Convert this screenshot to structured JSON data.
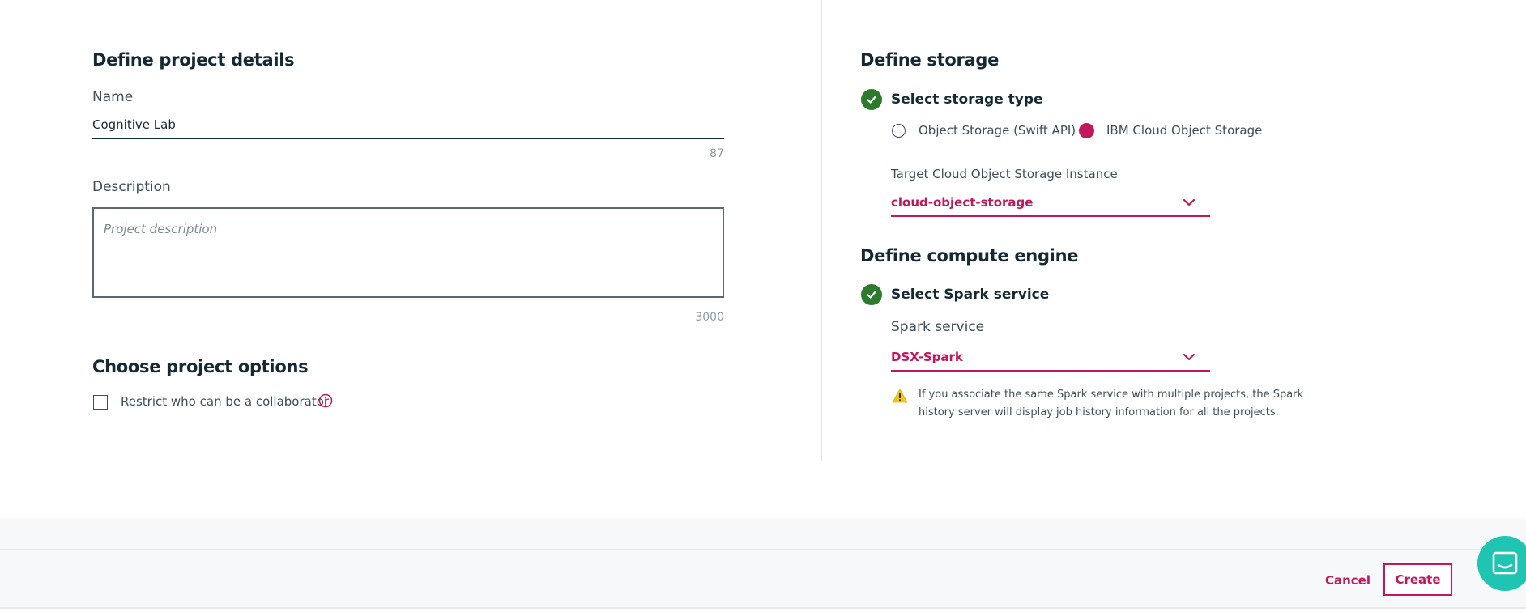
{
  "project_details": {
    "heading": "Define project details",
    "name_label": "Name",
    "name_value": "Cognitive Lab",
    "name_counter": "87",
    "description_label": "Description",
    "description_placeholder": "Project description",
    "description_counter": "3000"
  },
  "project_options": {
    "heading": "Choose project options",
    "restrict_label": "Restrict who can be a collaborator",
    "restrict_checked": false,
    "info_icon": "info-icon"
  },
  "storage": {
    "heading": "Define storage",
    "step_title": "Select storage type",
    "options": [
      {
        "label": "Object Storage (Swift API)",
        "selected": false
      },
      {
        "label": "IBM Cloud Object Storage",
        "selected": true
      }
    ],
    "instance_label": "Target Cloud Object Storage Instance",
    "instance_value": "cloud-object-storage"
  },
  "compute": {
    "heading": "Define compute engine",
    "step_title": "Select Spark service",
    "spark_label": "Spark service",
    "spark_value": "DSX-Spark",
    "warning_text": "If you associate the same Spark service with multiple projects, the Spark history server will display job history information for all the projects."
  },
  "footer": {
    "cancel_label": "Cancel",
    "create_label": "Create"
  },
  "colors": {
    "accent": "#c2185b",
    "success": "#2d7a2d",
    "text": "#152935",
    "chat": "#20c4b3",
    "warning": "#f5c518"
  }
}
